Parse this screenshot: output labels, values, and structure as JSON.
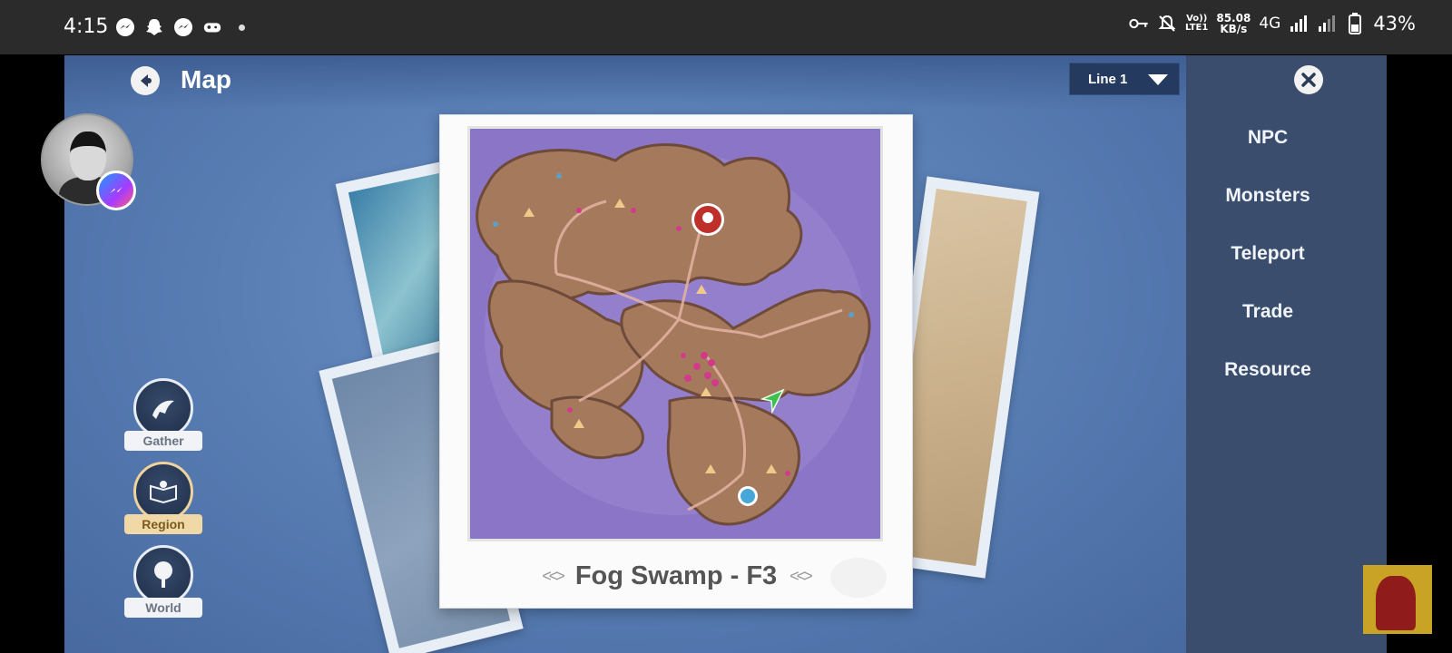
{
  "status_bar": {
    "time": "4:15",
    "volte_line1": "Vo))",
    "volte_line2": "LTE1",
    "speed_value": "85.08",
    "speed_unit": "KB/s",
    "network": "4G",
    "battery": "43%"
  },
  "header": {
    "title": "Map",
    "line_select": "Line 1"
  },
  "map": {
    "region_name": "Fog Swamp - F3"
  },
  "categories": [
    {
      "label": "Gather",
      "active": false
    },
    {
      "label": "Region",
      "active": true
    },
    {
      "label": "World",
      "active": false
    }
  ],
  "side_panel": {
    "items": [
      "NPC",
      "Monsters",
      "Teleport",
      "Trade",
      "Resource"
    ]
  },
  "colors": {
    "accent_active": "#f0d9a7",
    "side_panel_bg": "#3a4d6d",
    "map_bg": "#8b75c6"
  }
}
